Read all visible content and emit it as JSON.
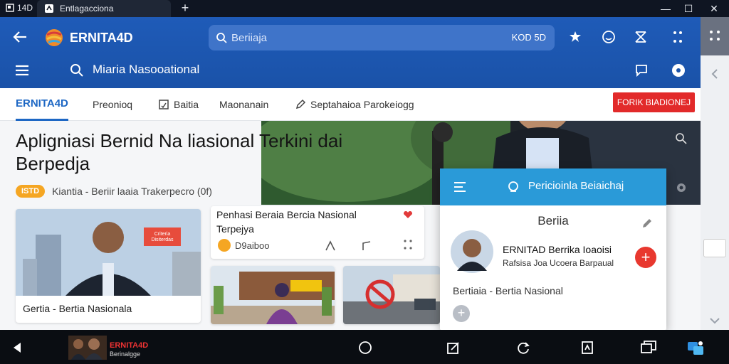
{
  "titlebar": {
    "app_tag": "14D",
    "tab_title": "Entlagacciona",
    "new_tab": "+",
    "minimize": "—",
    "maximize": "☐",
    "close": "✕"
  },
  "header": {
    "brand": "ERNITA4D",
    "search_placeholder": "Beriiaja",
    "zoom_label": "KOD 5D",
    "subtitle": "Miaria Nasooational"
  },
  "nav": {
    "items": [
      {
        "label": "ERNITA4D"
      },
      {
        "label": "Preonioq"
      },
      {
        "label": "Baitia"
      },
      {
        "label": "Maonanain"
      },
      {
        "label": "Septahaioa Parokeiogg"
      }
    ],
    "live_badge": "FORIK BIADIONEJ"
  },
  "article": {
    "headline": "Apligniasi Bernid Na liasional Terkini dai Berpedja",
    "tag": "ISTD",
    "meta_text": "Kiantia - Beriir laaia Trakerpecro (0f)"
  },
  "cards": [
    {
      "caption": "Gertia - Bertia Nasionala",
      "sign_text": "Criteria Disiterdas"
    },
    {
      "title": "Penhasi Beraia Bercia Nasional Terpejya",
      "tag": "D9aiboo"
    },
    {
      "image": "market-scene"
    },
    {
      "image": "road-scene"
    }
  ],
  "popup": {
    "bar_title": "Pericioinla Beiaichaj",
    "heading": "Beriia",
    "name": "ERNITAD Berrika Ioaoisi",
    "subtitle": "Rafsisa Joa Ucoera Barpaual",
    "footer": "Bertiaia - Bertia Nasional"
  },
  "taskbar": {
    "promo_title": "ERNITA4D",
    "promo_sub": "Berinalgge"
  },
  "colors": {
    "header_blue": "#1f5bb8",
    "accent_blue": "#1d67c4",
    "live_red": "#e22a2a",
    "popup_blue": "#2a9ad8",
    "tag_orange": "#f5a623"
  }
}
